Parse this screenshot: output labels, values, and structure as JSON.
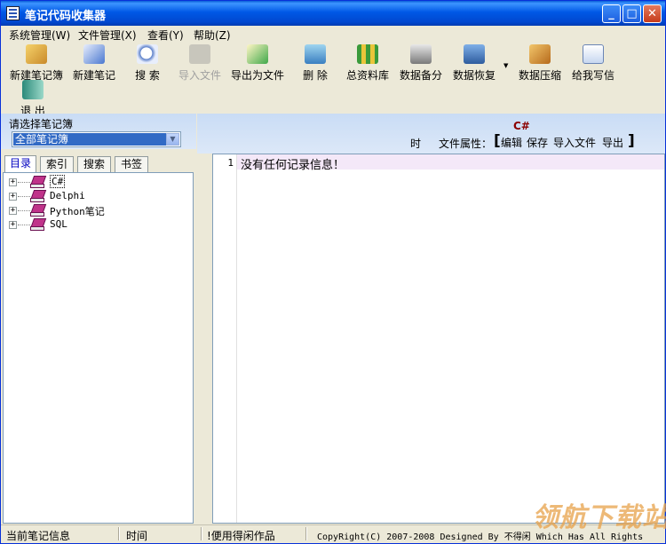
{
  "window": {
    "title": "笔记代码收集器"
  },
  "menu": [
    "系统管理(W)",
    "文件管理(X)",
    "查看(Y)",
    "帮助(Z)"
  ],
  "toolbar": {
    "new_notebook": "新建笔记簿",
    "new_note": "新建笔记",
    "search": "搜 索",
    "import_file": "导入文件",
    "export_file": "导出为文件",
    "delete": "删 除",
    "total_library": "总资料库",
    "data_backup": "数据备分",
    "data_restore": "数据恢复",
    "data_compress": "数据压缩",
    "write_letter": "给我写信",
    "exit": "退 出"
  },
  "left": {
    "select_label": "请选择笔记簿",
    "selected_notebook": "全部笔记簿",
    "tabs": [
      "目录",
      "索引",
      "搜索",
      "书签"
    ],
    "tree": [
      "C#",
      "Delphi",
      "Python笔记",
      "SQL"
    ]
  },
  "right": {
    "category": "C#",
    "time_label": "时",
    "attr_label": "文件属性：",
    "bracket_open": "[",
    "bracket_close": "]",
    "actions": [
      "编辑",
      "保存",
      "导入文件",
      "导出"
    ],
    "line_number": "1",
    "content": "没有任何记录信息！"
  },
  "status": {
    "current_note": "当前笔记信息",
    "time": "时间",
    "author": "!便用得闲作品",
    "copyright": "CopyRight(C) 2007-2008 Designed By 不得闲 Which Has All Rights"
  },
  "watermark": "领航下载站",
  "colors": {
    "title_blue": "#0058e6",
    "highlight": "#316ac5",
    "tab_active_text": "#0000c0"
  }
}
